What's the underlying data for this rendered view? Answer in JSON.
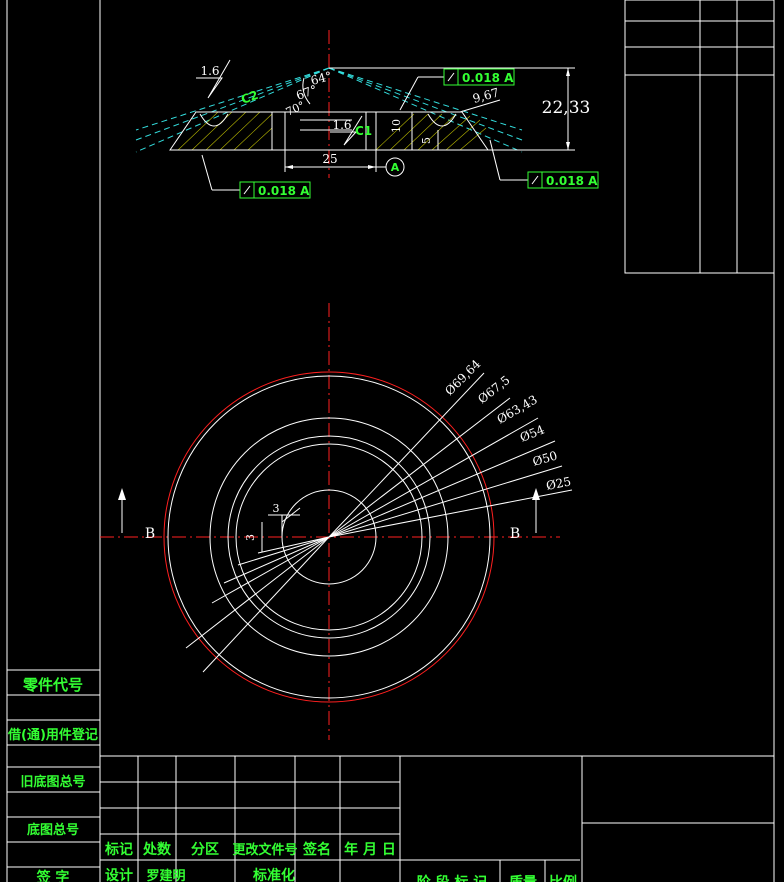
{
  "section_view": {
    "tolerance_1": "0.018 A",
    "tolerance_2": "0.018 A",
    "tolerance_3": "0.018 A",
    "datum": "A",
    "dim_height": "22,33",
    "dim_width": "25",
    "dim_roughness_left": "1.6",
    "dim_roughness_mid": "1.6",
    "dim_10": "10",
    "dim_5": "5",
    "dim_967": "9,67",
    "angle_64": "64°",
    "angle_67": "67°",
    "angle_70": "70°",
    "chamfer_c2": "C2",
    "chamfer_c1": "C1"
  },
  "plan_view": {
    "d1": "Ø69,64",
    "d2": "Ø67,5",
    "d3": "Ø63,43",
    "d4": "Ø54",
    "d5": "Ø50",
    "d6": "Ø25",
    "dim_3a": "3",
    "dim_3b": "3",
    "section_left": "B",
    "section_right": "B"
  },
  "left_panel": {
    "part_code": "零件代号",
    "used_register": "借(通)用件登记",
    "old_drawing": "旧底图总号",
    "base_drawing": "底图总号",
    "signature": "签 字"
  },
  "title_block": {
    "h1": "标记",
    "h2": "处数",
    "h3": "分区",
    "h4": "更改文件号",
    "h5": "签名",
    "h6": "年 月 日",
    "r1": "设计",
    "r2": "罗建明",
    "r3": "标准化",
    "r4": "阶 段 标 记",
    "r5": "质量",
    "r6": "比例"
  },
  "colors": {
    "background": "#000000",
    "lines": "#ffffff",
    "center_lines": "#ff2020",
    "construction": "#33dddd",
    "text": "#33ff33"
  }
}
